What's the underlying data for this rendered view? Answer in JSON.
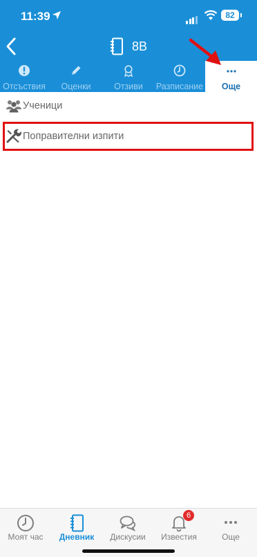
{
  "status": {
    "time": "11:39",
    "battery": "82"
  },
  "header": {
    "title": "8В"
  },
  "tabs": [
    {
      "label": "Отсъствия",
      "icon": "exclamation-icon"
    },
    {
      "label": "Оценки",
      "icon": "pencil-icon"
    },
    {
      "label": "Отзиви",
      "icon": "award-icon"
    },
    {
      "label": "Разписание",
      "icon": "clock-icon"
    },
    {
      "label": "Още",
      "icon": "more-dots-icon",
      "active": true
    }
  ],
  "list": [
    {
      "label": "Ученици",
      "icon": "users-icon"
    },
    {
      "label": "Поправителни изпити",
      "icon": "tools-icon"
    }
  ],
  "bottom_nav": [
    {
      "label": "Моят час",
      "icon": "clock-icon"
    },
    {
      "label": "Дневник",
      "icon": "notebook-icon",
      "active": true
    },
    {
      "label": "Дискусии",
      "icon": "chat-icon"
    },
    {
      "label": "Известия",
      "icon": "bell-icon",
      "badge": "6"
    },
    {
      "label": "Още",
      "icon": "more-dots-icon"
    }
  ],
  "colors": {
    "header": "#1a8fd8",
    "highlight": "#e01010",
    "active_nav": "#1a8fd8"
  }
}
